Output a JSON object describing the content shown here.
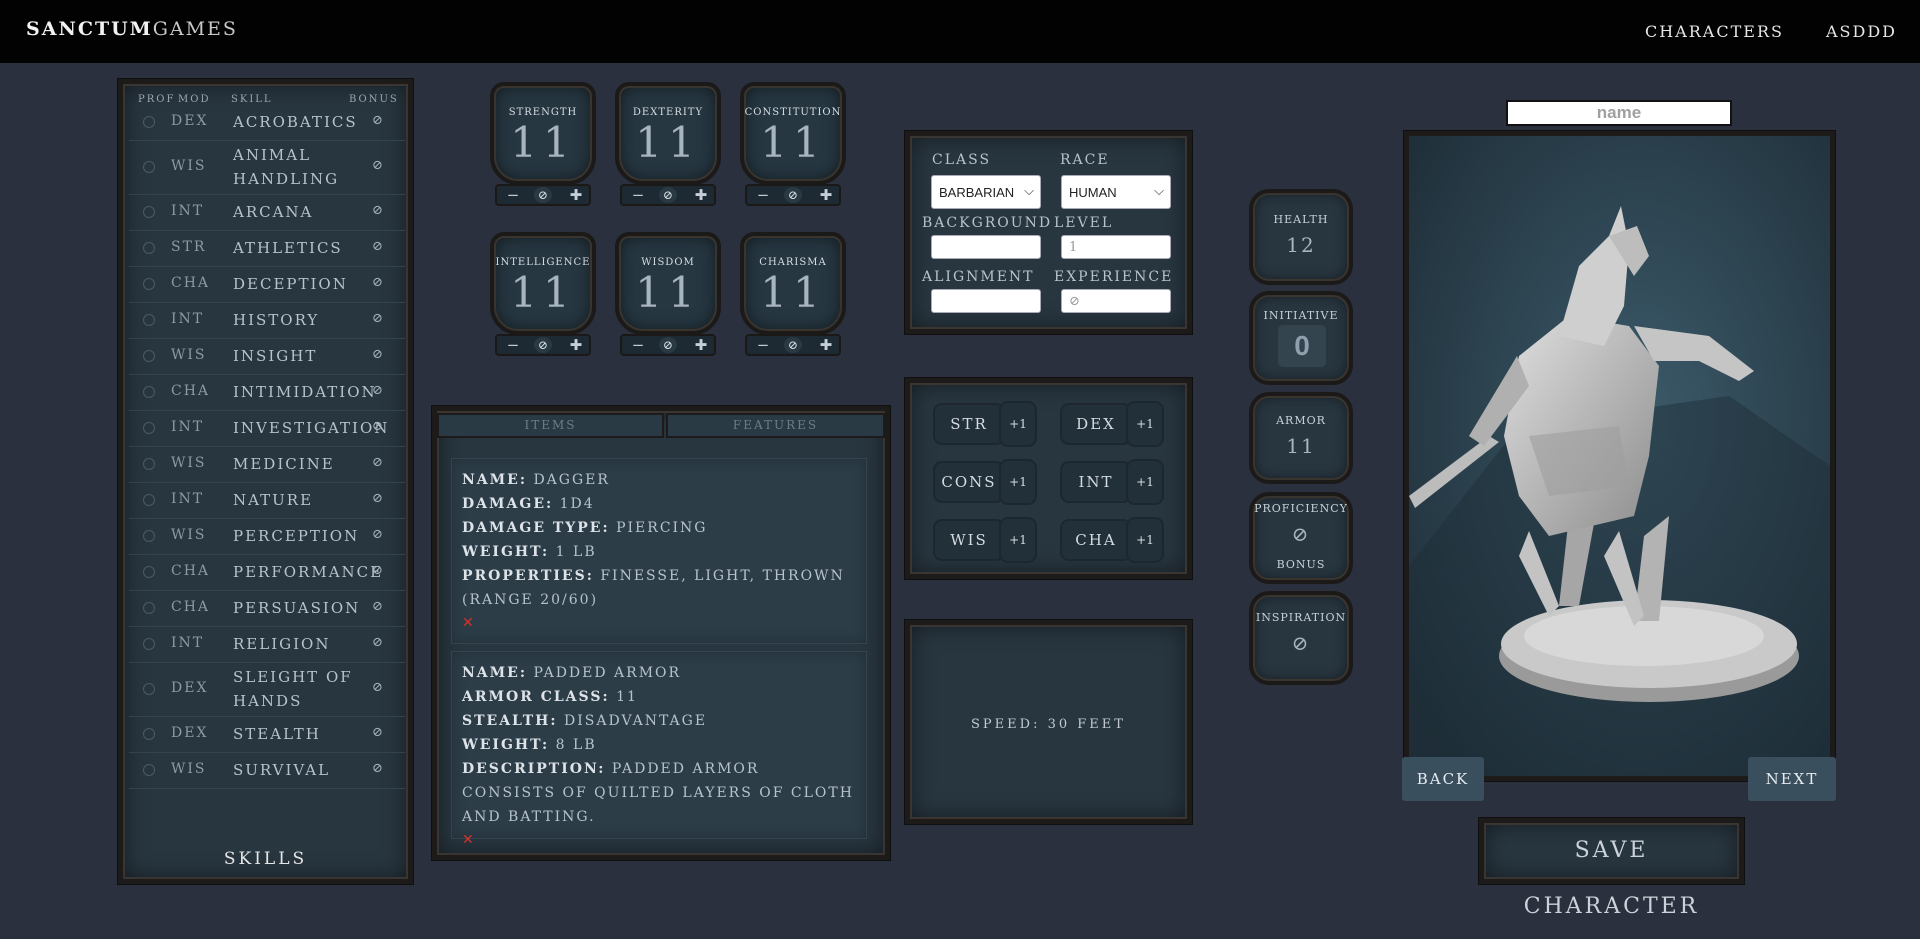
{
  "header": {
    "brand_part1": "SANCTUM",
    "brand_part2": "GAMES",
    "nav_characters": "CHARACTERS",
    "nav_user": "ASDDD"
  },
  "skills": {
    "headers": {
      "prof": "PROF",
      "mod": "MOD",
      "skill": "SKILL",
      "bonus": "BONUS"
    },
    "title": "SKILLS",
    "rows": [
      {
        "mod": "DEX",
        "name": "ACROBATICS",
        "bonus": "⊘"
      },
      {
        "mod": "WIS",
        "name": "ANIMAL HANDLING",
        "bonus": "⊘"
      },
      {
        "mod": "INT",
        "name": "ARCANA",
        "bonus": "⊘"
      },
      {
        "mod": "STR",
        "name": "ATHLETICS",
        "bonus": "⊘"
      },
      {
        "mod": "CHA",
        "name": "DECEPTION",
        "bonus": "⊘"
      },
      {
        "mod": "INT",
        "name": "HISTORY",
        "bonus": "⊘"
      },
      {
        "mod": "WIS",
        "name": "INSIGHT",
        "bonus": "⊘"
      },
      {
        "mod": "CHA",
        "name": "INTIMIDATION",
        "bonus": "⊘"
      },
      {
        "mod": "INT",
        "name": "INVESTIGATION",
        "bonus": "⊘"
      },
      {
        "mod": "WIS",
        "name": "MEDICINE",
        "bonus": "⊘"
      },
      {
        "mod": "INT",
        "name": "NATURE",
        "bonus": "⊘"
      },
      {
        "mod": "WIS",
        "name": "PERCEPTION",
        "bonus": "⊘"
      },
      {
        "mod": "CHA",
        "name": "PERFORMANCE",
        "bonus": "⊘"
      },
      {
        "mod": "CHA",
        "name": "PERSUASION",
        "bonus": "⊘"
      },
      {
        "mod": "INT",
        "name": "RELIGION",
        "bonus": "⊘"
      },
      {
        "mod": "DEX",
        "name": "SLEIGHT OF HANDS",
        "bonus": "⊘"
      },
      {
        "mod": "DEX",
        "name": "STEALTH",
        "bonus": "⊘"
      },
      {
        "mod": "WIS",
        "name": "SURVIVAL",
        "bonus": "⊘"
      }
    ]
  },
  "abilities": [
    {
      "label": "STRENGTH",
      "value": "11"
    },
    {
      "label": "DEXTERITY",
      "value": "11"
    },
    {
      "label": "CONSTITUTION",
      "value": "11"
    },
    {
      "label": "INTELLIGENCE",
      "value": "11"
    },
    {
      "label": "WISDOM",
      "value": "11"
    },
    {
      "label": "CHARISMA",
      "value": "11"
    }
  ],
  "ability_controls": {
    "minus": "−",
    "mid": "⊘",
    "plus": "✚"
  },
  "character": {
    "class_label": "CLASS",
    "class_value": "BARBARIAN",
    "race_label": "RACE",
    "race_value": "HUMAN",
    "background_label": "BACKGROUND",
    "background_value": "",
    "level_label": "LEVEL",
    "level_placeholder": "1",
    "alignment_label": "ALIGNMENT",
    "alignment_value": "",
    "experience_label": "EXPERIENCE",
    "experience_placeholder": "⊘"
  },
  "modifiers": [
    {
      "name": "STR",
      "value": "+1"
    },
    {
      "name": "DEX",
      "value": "+1"
    },
    {
      "name": "CONS",
      "value": "+1"
    },
    {
      "name": "INT",
      "value": "+1"
    },
    {
      "name": "WIS",
      "value": "+1"
    },
    {
      "name": "CHA",
      "value": "+1"
    }
  ],
  "speed": "SPEED: 30 FEET",
  "tabs": {
    "items": "ITEMS",
    "features": "FEATURES"
  },
  "items": [
    {
      "lines": [
        {
          "key": "NAME:",
          "value": " DAGGER"
        },
        {
          "key": "DAMAGE:",
          "value": " 1D4"
        },
        {
          "key": "DAMAGE TYPE:",
          "value": " PIERCING"
        },
        {
          "key": "WEIGHT:",
          "value": " 1 LB"
        },
        {
          "key": "PROPERTIES:",
          "value": " FINESSE, LIGHT, THROWN (RANGE 20/60)"
        }
      ],
      "delete": "✕"
    },
    {
      "lines": [
        {
          "key": "NAME:",
          "value": " PADDED ARMOR"
        },
        {
          "key": "ARMOR CLASS:",
          "value": " 11"
        },
        {
          "key": "STEALTH:",
          "value": " DISADVANTAGE"
        },
        {
          "key": "WEIGHT:",
          "value": " 8 LB"
        },
        {
          "key": "DESCRIPTION:",
          "value": " PADDED ARMOR CONSISTS OF QUILTED LAYERS OF CLOTH AND BATTING."
        }
      ],
      "delete": "✕"
    }
  ],
  "stats": {
    "health_label": "HEALTH",
    "health_value": "12",
    "initiative_label": "INITIATIVE",
    "initiative_value": "0",
    "armor_label": "ARMOR",
    "armor_value": "11",
    "proficiency_label": "PROFICIENCY",
    "proficiency_value": "⊘",
    "proficiency_sub": "BONUS",
    "inspiration_label": "INSPIRATION",
    "inspiration_value": "⊘"
  },
  "portrait": {
    "name_placeholder": "name",
    "back": "BACK",
    "next": "NEXT",
    "save": "SAVE CHARACTER"
  },
  "colors": {
    "accent_delete": "#d0342c",
    "background": "#2a303d",
    "panel": "#283640",
    "header": "#020202"
  }
}
